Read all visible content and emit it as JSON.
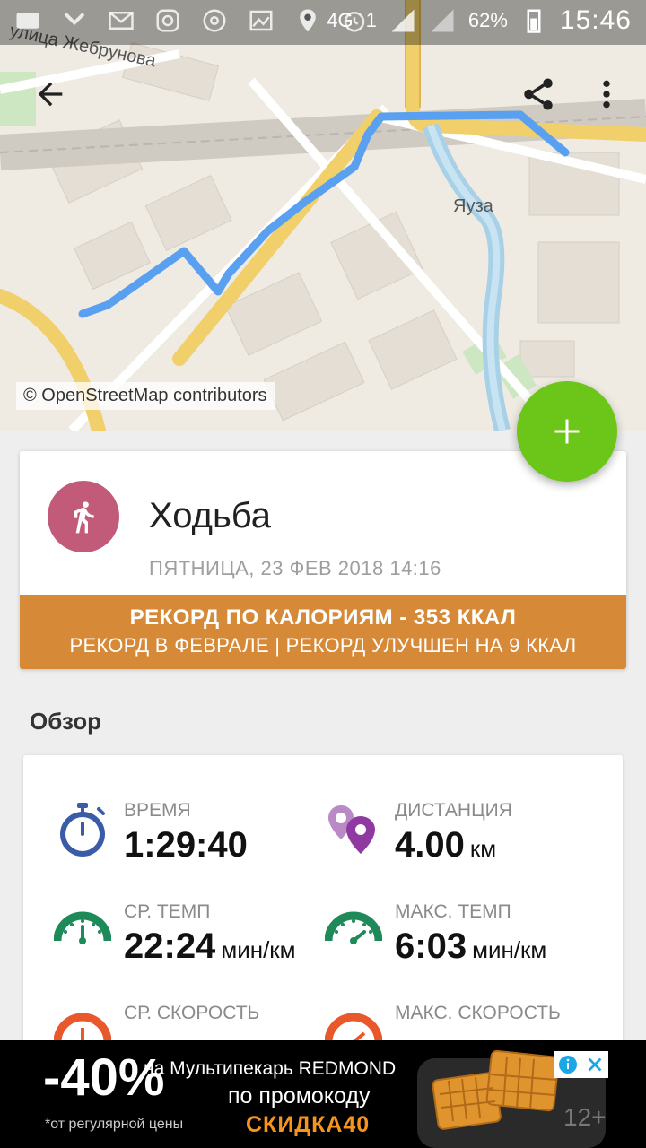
{
  "status_bar": {
    "network": "4G",
    "sim": "1",
    "battery": "62%",
    "time": "15:46"
  },
  "map": {
    "street_label": "улица Жебрунова",
    "river_label": "Яуза",
    "credit": "© OpenStreetMap contributors",
    "route_color": "#5aa0f0"
  },
  "activity": {
    "title": "Ходьба",
    "date": "ПЯТНИЦА, 23 ФЕВ 2018 14:16",
    "icon": "walking-icon",
    "icon_color": "#c25a7a",
    "record_line1": "РЕКОРД ПО КАЛОРИЯМ  -  353 ККАЛ",
    "record_line2": "РЕКОРД В ФЕВРАЛЕ  |  РЕКОРД УЛУЧШЕН НА 9 ККАЛ",
    "record_color": "#d68a38"
  },
  "overview": {
    "title": "Обзор",
    "stats": [
      {
        "label": "ВРЕМЯ",
        "value": "1:29:40",
        "unit": "",
        "icon": "stopwatch-icon"
      },
      {
        "label": "ДИСТАНЦИЯ",
        "value": "4.00",
        "unit": "км",
        "icon": "location-pins-icon"
      },
      {
        "label": "СР. ТЕМП",
        "value": "22:24",
        "unit": "мин/км",
        "icon": "speedometer-icon"
      },
      {
        "label": "МАКС. ТЕМП",
        "value": "6:03",
        "unit": "мин/км",
        "icon": "speedometer-icon"
      },
      {
        "label": "СР. СКОРОСТЬ",
        "value": "",
        "unit": "",
        "icon": "speed-gauge-icon"
      },
      {
        "label": "МАКС. СКОРОСТЬ",
        "value": "",
        "unit": "",
        "icon": "speed-gauge-icon"
      }
    ]
  },
  "ad": {
    "discount": "-40%",
    "note": "*от регулярной цены",
    "line1": "на Мультипекарь REDMOND",
    "line2": "по промокоду",
    "code": "СКИДКА40",
    "age": "12+"
  },
  "colors": {
    "fab": "#6cc519",
    "accent_green": "#1e8a5a",
    "accent_blue": "#3a5ca8",
    "accent_purple": "#8e3aa0",
    "accent_orange": "#e8582a"
  }
}
